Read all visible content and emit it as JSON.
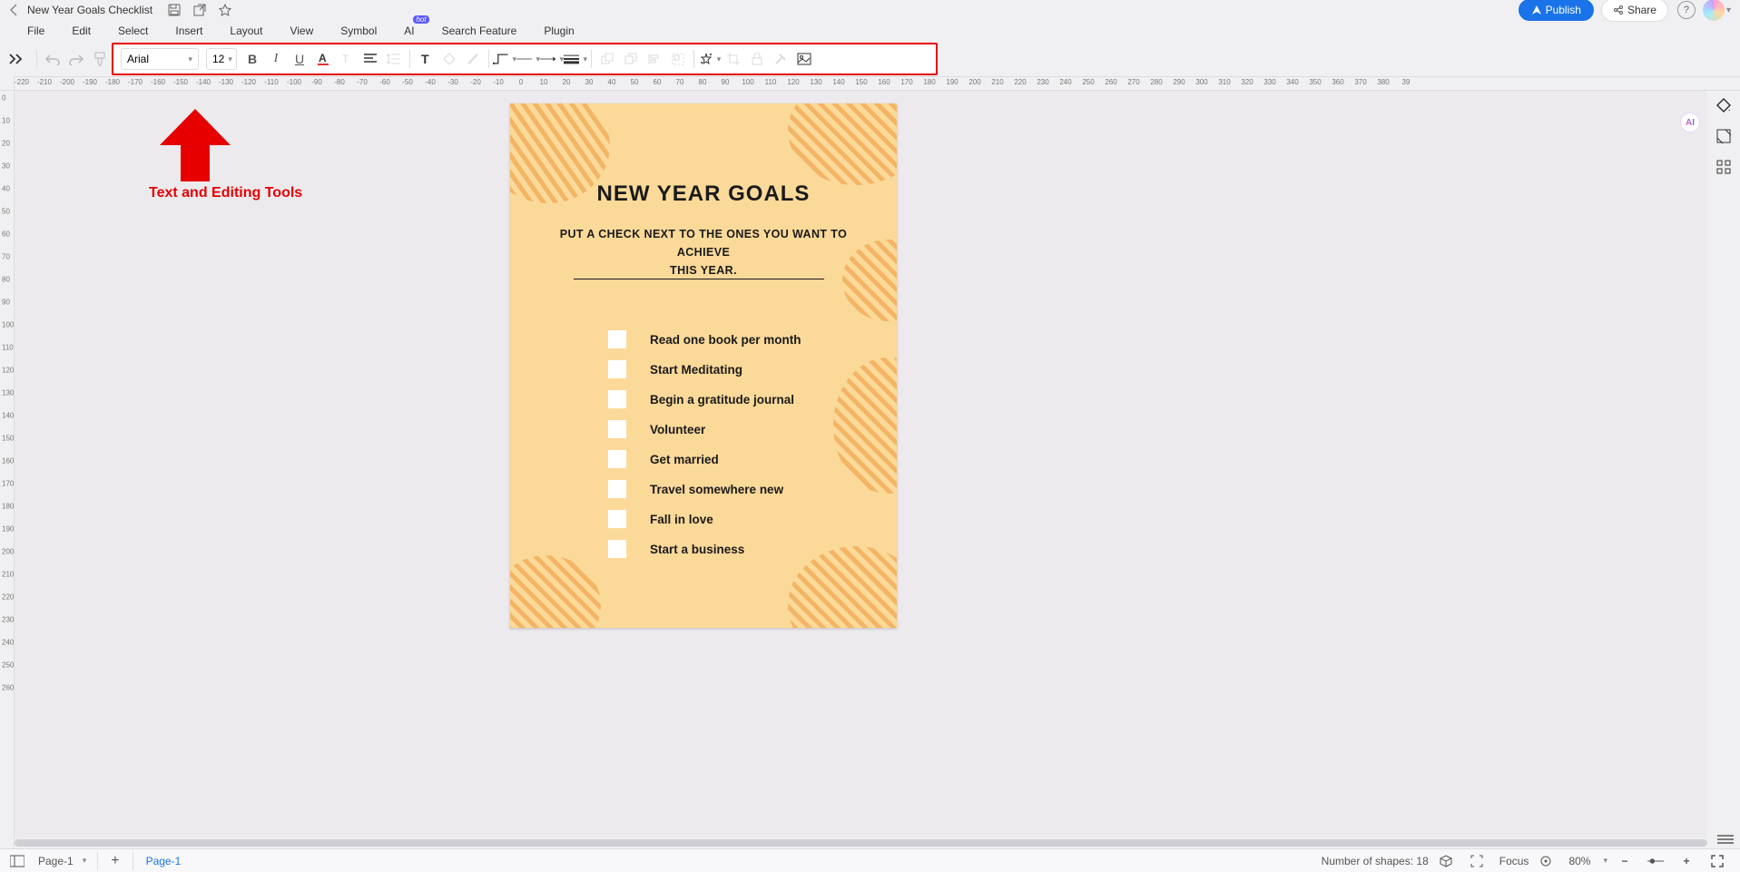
{
  "header": {
    "doc_title": "New Year Goals Checklist",
    "publish": "Publish",
    "share": "Share"
  },
  "menu": {
    "file": "File",
    "edit": "Edit",
    "select": "Select",
    "insert": "Insert",
    "layout": "Layout",
    "view": "View",
    "symbol": "Symbol",
    "ai": "AI",
    "ai_badge": "hot",
    "search": "Search Feature",
    "plugin": "Plugin"
  },
  "toolbar": {
    "font_name": "Arial",
    "font_size": "12"
  },
  "annotation_label": "Text and Editing Tools",
  "page": {
    "title": "NEW YEAR GOALS",
    "subtitle_l1": "PUT A CHECK NEXT TO THE ONES YOU WANT TO",
    "subtitle_l2": "ACHIEVE",
    "subtitle_l3": "THIS YEAR.",
    "items": {
      "0": "Read one book per month",
      "1": "Start Meditating",
      "2": "Begin a gratitude journal",
      "3": "Volunteer",
      "4": "Get married",
      "5": "Travel somewhere new",
      "6": "Fall in love",
      "7": "Start a business"
    }
  },
  "ruler_h": {
    "0": "-220",
    "1": "-210",
    "2": "-200",
    "3": "-190",
    "4": "-180",
    "5": "-170",
    "6": "-160",
    "7": "-150",
    "8": "-140",
    "9": "-130",
    "10": "-120",
    "11": "-110",
    "12": "-100",
    "13": "-90",
    "14": "-80",
    "15": "-70",
    "16": "-60",
    "17": "-50",
    "18": "-40",
    "19": "-30",
    "20": "-20",
    "21": "-10",
    "22": "0",
    "23": "10",
    "24": "20",
    "25": "30",
    "26": "40",
    "27": "50",
    "28": "60",
    "29": "70",
    "30": "80",
    "31": "90",
    "32": "100",
    "33": "110",
    "34": "120",
    "35": "130",
    "36": "140",
    "37": "150",
    "38": "160",
    "39": "170",
    "40": "180",
    "41": "190",
    "42": "200",
    "43": "210",
    "44": "220",
    "45": "230",
    "46": "240",
    "47": "250",
    "48": "260",
    "49": "270",
    "50": "280",
    "51": "290",
    "52": "300",
    "53": "310",
    "54": "320",
    "55": "330",
    "56": "340",
    "57": "350",
    "58": "360",
    "59": "370",
    "60": "380",
    "61": "39"
  },
  "ruler_v": {
    "0": "0",
    "1": "10",
    "2": "20",
    "3": "30",
    "4": "40",
    "5": "50",
    "6": "60",
    "7": "70",
    "8": "80",
    "9": "90",
    "10": "100",
    "11": "110",
    "12": "120",
    "13": "130",
    "14": "140",
    "15": "150",
    "16": "160",
    "17": "170",
    "18": "180",
    "19": "190",
    "20": "200",
    "21": "210",
    "22": "220",
    "23": "230",
    "24": "240",
    "25": "250",
    "26": "260"
  },
  "bottom": {
    "page_select": "Page-1",
    "tab_active": "Page-1",
    "shapes_count": "Number of shapes: 18",
    "focus": "Focus",
    "zoom": "80%"
  },
  "ai_badge_right": "AI"
}
